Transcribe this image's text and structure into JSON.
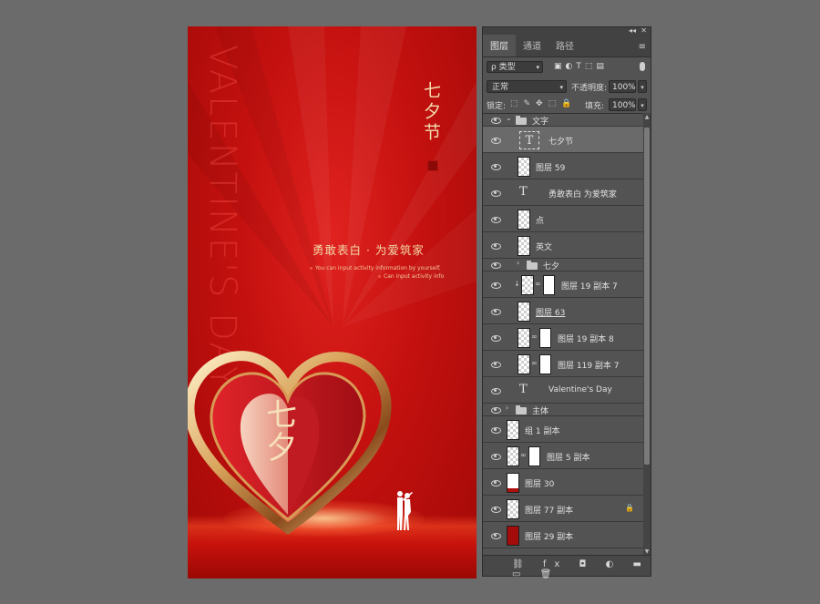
{
  "poster": {
    "vertical_english": "VALENTINE'S DAY",
    "title_cn": "七夕节",
    "slogan": "勇敢表白 · 为爱筑家",
    "line1": "You can input activity information by yourself.",
    "line2": "Can input activity info",
    "heart_char": "七\n夕"
  },
  "panel": {
    "tabs": [
      "图层",
      "通道",
      "路径"
    ],
    "filter_label": "ρ 类型",
    "blend_mode": "正常",
    "opacity_label": "不透明度:",
    "opacity_value": "100%",
    "lock_label": "锁定:",
    "fill_label": "填充:",
    "fill_value": "100%",
    "bottom_icons": "⛓ fx ◘ ◐ ▬ ▭ 🗑"
  },
  "layers": [
    {
      "name": "文字",
      "kind": "group-open",
      "indent": 0
    },
    {
      "name": "七夕节",
      "kind": "text-selected",
      "indent": 1
    },
    {
      "name": "图层 59",
      "kind": "raster",
      "indent": 1
    },
    {
      "name": "勇敢表白 为爱筑家",
      "kind": "text",
      "indent": 1
    },
    {
      "name": "点",
      "kind": "raster",
      "indent": 1
    },
    {
      "name": "英文",
      "kind": "raster",
      "indent": 1
    },
    {
      "name": "七夕",
      "kind": "group-closed",
      "indent": 1
    },
    {
      "name": "图层 19 副本 7",
      "kind": "clip-masked",
      "indent": 1
    },
    {
      "name": "图层 63",
      "kind": "raster-underline",
      "indent": 1
    },
    {
      "name": "图层 19 副本 8",
      "kind": "masked",
      "indent": 1
    },
    {
      "name": "图层 119 副本 7",
      "kind": "masked",
      "indent": 1
    },
    {
      "name": "Valentine's Day",
      "kind": "text",
      "indent": 1
    },
    {
      "name": "主体",
      "kind": "group-closed",
      "indent": 0
    },
    {
      "name": "组 1 副本",
      "kind": "raster",
      "indent": 0
    },
    {
      "name": "图层 5 副本",
      "kind": "masked",
      "indent": 0
    },
    {
      "name": "图层 30",
      "kind": "redbar",
      "indent": 0
    },
    {
      "name": "图层 77 副本",
      "kind": "locked",
      "indent": 0
    },
    {
      "name": "图层 29 副本",
      "kind": "red",
      "indent": 0
    }
  ],
  "colors": {
    "poster_red": "#c4110f",
    "gold": "#f2d7a7",
    "panel_bg": "#535353",
    "workspace": "#6b6b6b"
  }
}
